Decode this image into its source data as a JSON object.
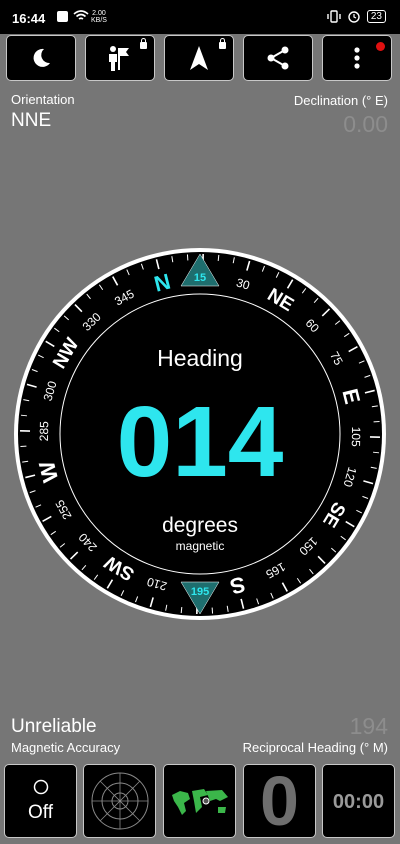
{
  "status_bar": {
    "time": "16:44",
    "net_speed_value": "2.00",
    "net_speed_unit": "KB/S",
    "battery": "23"
  },
  "toolbar": {
    "buttons": [
      {
        "name": "night-mode-button",
        "icon": "moon-icon"
      },
      {
        "name": "map-guide-button",
        "icon": "person-flag-icon",
        "locked": true
      },
      {
        "name": "navigation-button",
        "icon": "arrow-up-icon",
        "locked": true
      },
      {
        "name": "share-button",
        "icon": "share-icon"
      },
      {
        "name": "more-menu-button",
        "icon": "vertical-dots-icon",
        "badge_color": "#e01010"
      }
    ]
  },
  "orientation": {
    "label": "Orientation",
    "value": "NNE"
  },
  "declination": {
    "label": "Declination (° E)",
    "value": "0.00"
  },
  "compass": {
    "heading_label": "Heading",
    "heading_value": "014",
    "unit_label": "degrees",
    "reference_label": "magnetic",
    "top_marker_value": "15",
    "bottom_marker_value": "195",
    "cardinals": [
      {
        "label": "N",
        "angle": -14,
        "color": "#2ee6ee"
      },
      {
        "label": "NE",
        "angle": 31
      },
      {
        "label": "E",
        "angle": 76
      },
      {
        "label": "SE",
        "angle": 121
      },
      {
        "label": "S",
        "angle": 166
      },
      {
        "label": "SW",
        "angle": 211
      },
      {
        "label": "W",
        "angle": 256
      },
      {
        "label": "NW",
        "angle": 301
      }
    ],
    "degree_labels": [
      "15",
      "30",
      "60",
      "75",
      "105",
      "120",
      "150",
      "165",
      "210",
      "255",
      "240",
      "285",
      "300",
      "330",
      "345"
    ]
  },
  "magnetic_accuracy": {
    "value": "Unreliable",
    "label": "Magnetic Accuracy"
  },
  "reciprocal_heading": {
    "value": "194",
    "label": "Reciprocal Heading (° M)"
  },
  "bottom_bar": {
    "off_button_label": "Off",
    "level_digit": "0",
    "timer": "00:00"
  },
  "colors": {
    "accent": "#2ee6ee",
    "background": "#767676",
    "button_bg": "#000000"
  }
}
